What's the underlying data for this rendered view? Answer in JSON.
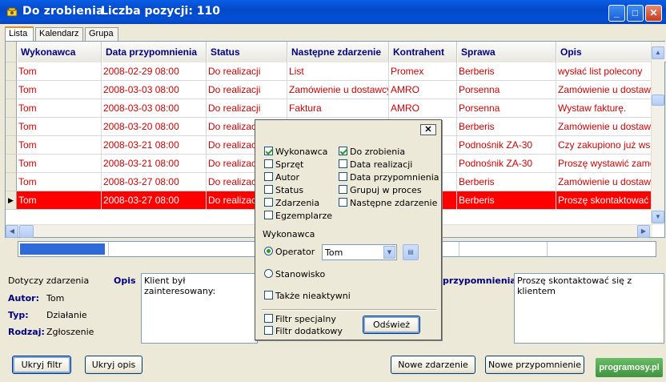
{
  "window": {
    "title": "Do zrobienia",
    "count_label": "Liczba pozycji: 110",
    "minimize": "_",
    "maximize": "□",
    "close": "✕"
  },
  "tabs": [
    {
      "label": "Lista"
    },
    {
      "label": "Kalendarz"
    },
    {
      "label": "Grupa"
    }
  ],
  "grid": {
    "columns": [
      "Wykonawca",
      "Data przypomnienia",
      "Status",
      "Następne zdarzenie",
      "Kontrahent",
      "Sprawa",
      "Opis"
    ],
    "rows": [
      [
        "Tom",
        "2008-02-29 08:00",
        "Do realizacji",
        "List",
        "Promex",
        "Berberis",
        "wysłać list polecony"
      ],
      [
        "Tom",
        "2008-03-03 08:00",
        "Do realizacji",
        "Zamówienie u dostawcy",
        "AMRO",
        "Porsenna",
        "Zamówienie u dostawcy"
      ],
      [
        "Tom",
        "2008-03-03 08:00",
        "Do realizacji",
        "Faktura",
        "AMRO",
        "Porsenna",
        "Wystaw fakturę."
      ],
      [
        "Tom",
        "2008-03-20 08:00",
        "Do realizacji",
        "",
        "",
        "Berberis",
        "Zamówienie u dostawcy"
      ],
      [
        "Tom",
        "2008-03-21 08:00",
        "Do realizacji",
        "",
        "",
        "Podnośnik ZA-30",
        "Czy zakupiono już wszystko"
      ],
      [
        "Tom",
        "2008-03-21 08:00",
        "Do realizacji",
        "",
        "",
        "Podnośnik ZA-30",
        "Proszę wystawić zamówienie"
      ],
      [
        "Tom",
        "2008-03-27 08:00",
        "Do realizacji",
        "",
        "",
        "Berberis",
        "Zamówienie u dostawcy"
      ],
      [
        "Tom",
        "2008-03-27 08:00",
        "Do realizacji",
        "",
        "",
        "Berberis",
        "Proszę skontaktować się z klientem"
      ]
    ],
    "selected_row": 7
  },
  "details": {
    "dotyczy_label": "Dotyczy zdarzenia",
    "opis_label": "Opis",
    "autor_label": "Autor:",
    "autor_value": "Tom",
    "typ_label": "Typ:",
    "typ_value": "Działanie",
    "rodzaj_label": "Rodzaj:",
    "rodzaj_value": "Zgłoszenie",
    "opis_text": "Klient był zainteresowany:",
    "przypomnienia_label": "przypomnienia",
    "przypomnienia_text": "Proszę skontaktować się z klientem"
  },
  "buttons": {
    "ukryj_filtr": "Ukryj filtr",
    "ukryj_opis": "Ukryj opis",
    "nowe_zdarzenie": "Nowe zdarzenie",
    "nowe_przypomnienie": "Nowe przypomnienie"
  },
  "filter_popup": {
    "close": "✕",
    "checkboxes_left": [
      {
        "label": "Wykonawca",
        "checked": true
      },
      {
        "label": "Sprzęt",
        "checked": false
      },
      {
        "label": "Autor",
        "checked": false
      },
      {
        "label": "Status",
        "checked": false
      },
      {
        "label": "Zdarzenia",
        "checked": false
      },
      {
        "label": "Egzemplarze",
        "checked": false
      }
    ],
    "checkboxes_right": [
      {
        "label": "Do zrobienia",
        "checked": true
      },
      {
        "label": "Data realizacji",
        "checked": false
      },
      {
        "label": "Data przypomnienia",
        "checked": false
      },
      {
        "label": "Grupuj w proces",
        "checked": false
      },
      {
        "label": "Następne zdarzenie",
        "checked": false
      }
    ],
    "wykonawca_label": "Wykonawca",
    "radio_operator": "Operator",
    "radio_stanowisko": "Stanowisko",
    "operator_value": "Tom",
    "takze_nieaktywni": "Także nieaktywni",
    "filtr_specjalny": "Filtr specjalny",
    "filtr_dodatkowy": "Filtr dodatkowy",
    "odswiez": "Odśwież"
  },
  "watermark": "programosy.pl"
}
